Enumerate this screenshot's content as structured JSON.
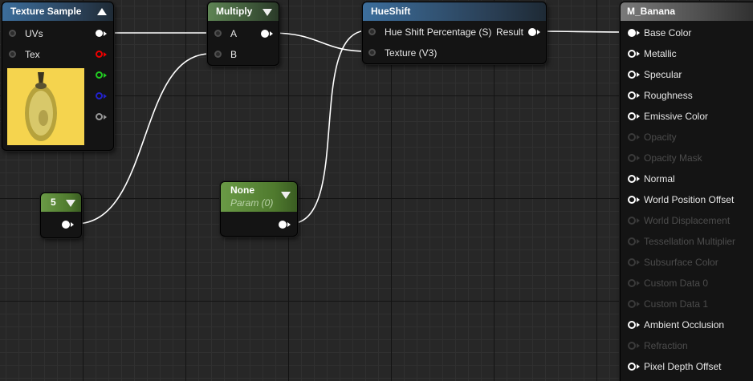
{
  "texture_sample": {
    "title": "Texture Sample",
    "inputs": [
      {
        "label": "UVs"
      },
      {
        "label": "Tex"
      }
    ],
    "output_colors": [
      "#ffffff",
      "#ee0000",
      "#22cc22",
      "#2222cc",
      "#999999"
    ]
  },
  "multiply": {
    "title": "Multiply",
    "inputs": [
      {
        "label": "A"
      },
      {
        "label": "B"
      }
    ]
  },
  "hueshift": {
    "title": "HueShift",
    "inputs": [
      {
        "label": "Hue Shift Percentage (S)"
      },
      {
        "label": "Texture (V3)"
      }
    ],
    "output": "Result"
  },
  "constant": {
    "value": "5"
  },
  "param": {
    "title": "None",
    "subtitle": "Param (0)"
  },
  "material": {
    "title": "M_Banana",
    "pins": [
      {
        "label": "Base Color",
        "state": "connected"
      },
      {
        "label": "Metallic",
        "state": "enabled"
      },
      {
        "label": "Specular",
        "state": "enabled"
      },
      {
        "label": "Roughness",
        "state": "enabled"
      },
      {
        "label": "Emissive Color",
        "state": "enabled"
      },
      {
        "label": "Opacity",
        "state": "disabled"
      },
      {
        "label": "Opacity Mask",
        "state": "disabled"
      },
      {
        "label": "Normal",
        "state": "enabled"
      },
      {
        "label": "World Position Offset",
        "state": "enabled"
      },
      {
        "label": "World Displacement",
        "state": "disabled"
      },
      {
        "label": "Tessellation Multiplier",
        "state": "disabled"
      },
      {
        "label": "Subsurface Color",
        "state": "disabled"
      },
      {
        "label": "Custom Data 0",
        "state": "disabled"
      },
      {
        "label": "Custom Data 1",
        "state": "disabled"
      },
      {
        "label": "Ambient Occlusion",
        "state": "enabled"
      },
      {
        "label": "Refraction",
        "state": "disabled"
      },
      {
        "label": "Pixel Depth Offset",
        "state": "enabled"
      }
    ]
  },
  "colors": {
    "wire": "#ffffff",
    "grid": "#272727"
  }
}
